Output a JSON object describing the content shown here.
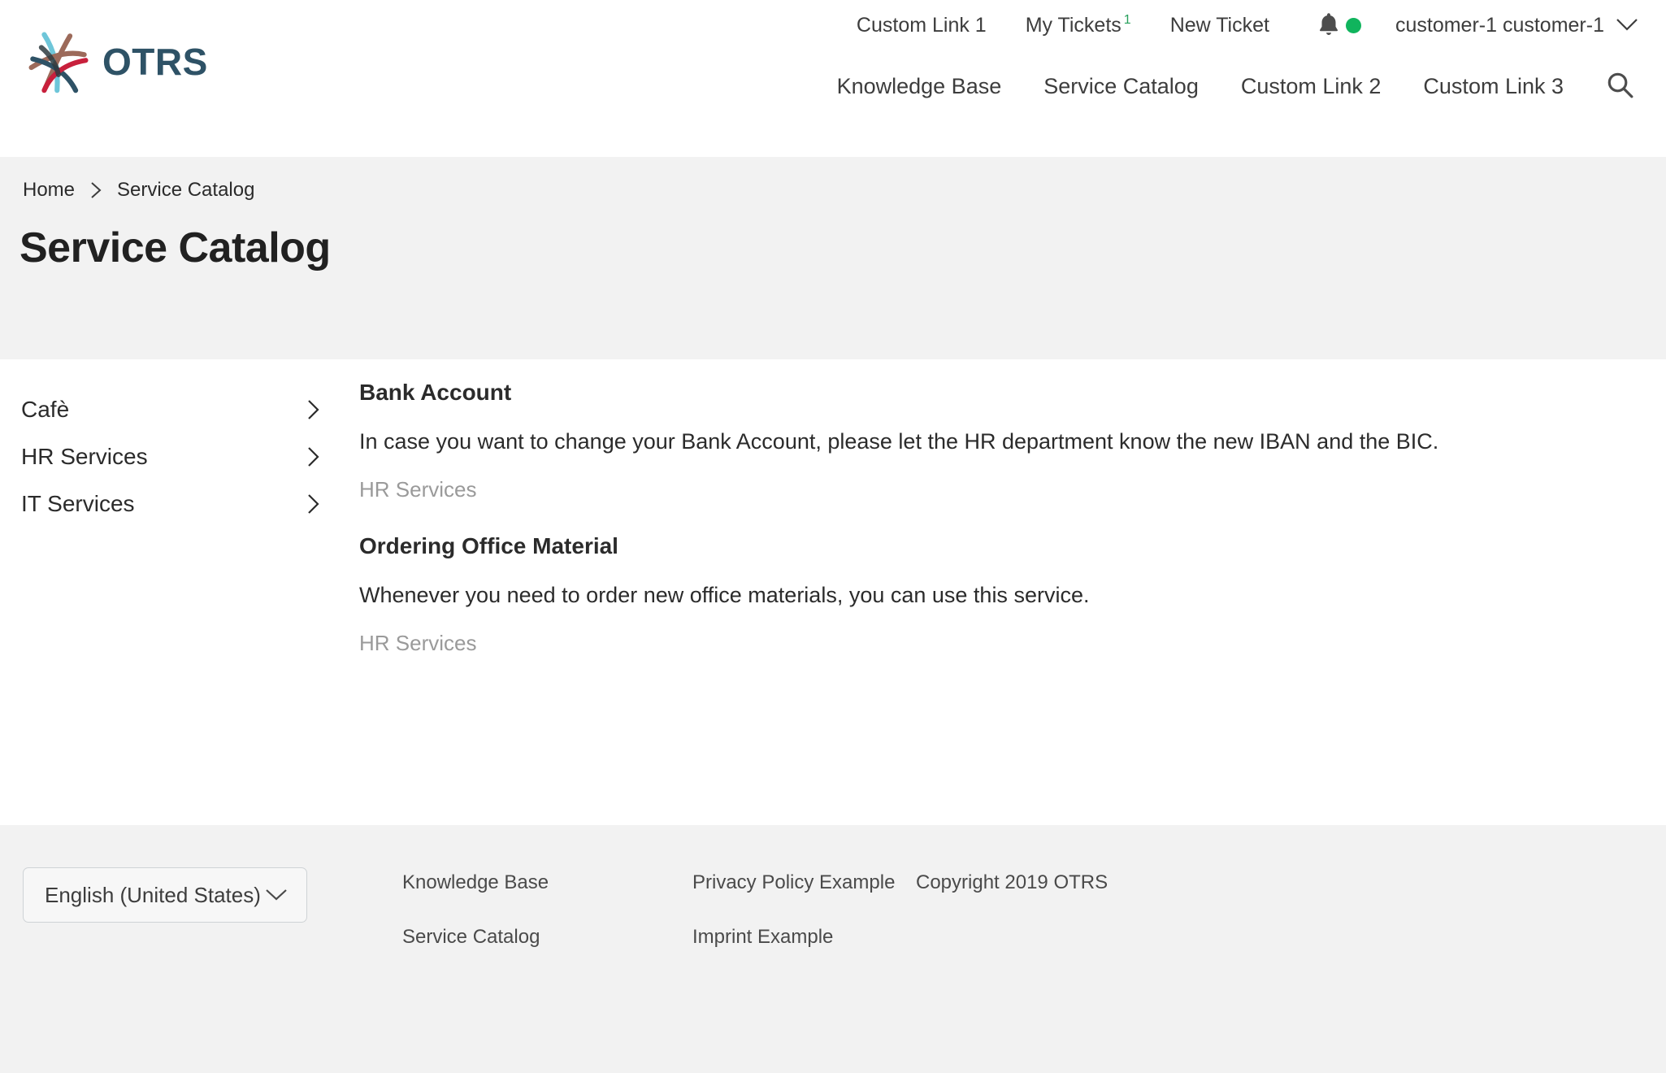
{
  "brand": {
    "logo_text": "OTRS",
    "logo_icon": "otrs-crossing-strokes-logo",
    "colors": {
      "logo_text": "#2e5266",
      "logo_teal": "#6ec6d9",
      "logo_darkblue": "#2e5266",
      "logo_brown": "#9c6a5a",
      "logo_red": "#c8203c",
      "accent_green": "#10b45d",
      "band_gray": "#f2f2f2"
    }
  },
  "topbar": {
    "links": [
      {
        "label": "Custom Link 1",
        "name": "custom-link-1"
      },
      {
        "label": "My Tickets",
        "name": "my-tickets",
        "badge": "1"
      },
      {
        "label": "New Ticket",
        "name": "new-ticket"
      }
    ],
    "notification_icon": "bell-icon",
    "status_dot": "online-status-dot",
    "user": "customer-1 customer-1",
    "user_chevron": "chevron-down-icon"
  },
  "mainnav": {
    "links": [
      {
        "label": "Knowledge Base",
        "name": "knowledge-base"
      },
      {
        "label": "Service Catalog",
        "name": "service-catalog"
      },
      {
        "label": "Custom Link 2",
        "name": "custom-link-2"
      },
      {
        "label": "Custom Link 3",
        "name": "custom-link-3"
      }
    ],
    "search_icon": "search-icon"
  },
  "breadcrumb": {
    "home": "Home",
    "separator_icon": "chevron-right-icon",
    "current": "Service Catalog"
  },
  "page": {
    "title": "Service Catalog"
  },
  "sidebar": {
    "items": [
      {
        "label": "Cafè",
        "name": "sidebar-item-cafe",
        "chevron": "chevron-right-icon"
      },
      {
        "label": "HR Services",
        "name": "sidebar-item-hr-services",
        "chevron": "chevron-right-icon"
      },
      {
        "label": "IT Services",
        "name": "sidebar-item-it-services",
        "chevron": "chevron-right-icon"
      }
    ]
  },
  "services": [
    {
      "title": "Bank Account",
      "description": "In case you want to change your Bank Account, please let the HR department know the new IBAN and the BIC.",
      "category": "HR Services"
    },
    {
      "title": "Ordering Office Material",
      "description": "Whenever you need to order new office materials, you can use this service.",
      "category": "HR Services"
    }
  ],
  "footer": {
    "language": {
      "value": "English (United States)",
      "chevron": "chevron-down-icon"
    },
    "column1": [
      {
        "label": "Knowledge Base",
        "name": "footer-knowledge-base"
      },
      {
        "label": "Service Catalog",
        "name": "footer-service-catalog"
      }
    ],
    "column2": [
      {
        "label": "Privacy Policy Example",
        "name": "footer-privacy-policy"
      },
      {
        "label": "Imprint Example",
        "name": "footer-imprint"
      }
    ],
    "copyright": "Copyright 2019 OTRS"
  }
}
